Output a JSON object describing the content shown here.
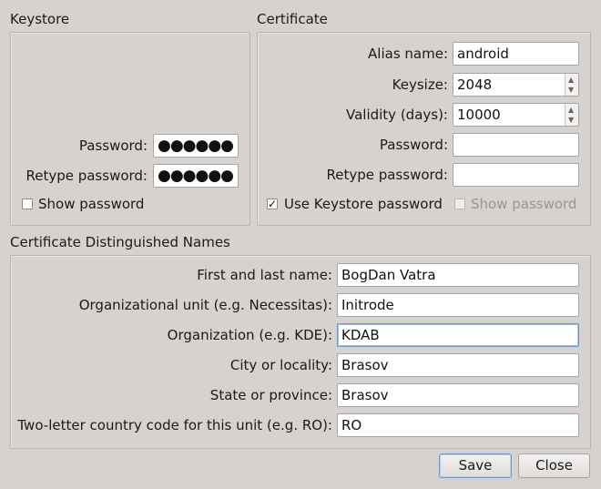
{
  "keystore": {
    "title": "Keystore",
    "password_label": "Password:",
    "password_value": "●●●●●●",
    "retype_label": "Retype password:",
    "retype_value": "●●●●●●",
    "show_password_label": "Show password",
    "show_password_checked": false
  },
  "certificate": {
    "title": "Certificate",
    "alias_label": "Alias name:",
    "alias_value": "android",
    "keysize_label": "Keysize:",
    "keysize_value": "2048",
    "validity_label": "Validity (days):",
    "validity_value": "10000",
    "password_label": "Password:",
    "password_value": "",
    "retype_label": "Retype password:",
    "retype_value": "",
    "use_keystore_password_label": "Use Keystore password",
    "use_keystore_password_checked": true,
    "use_keystore_password_mark": "✓",
    "show_password_label": "Show password",
    "show_password_enabled": false
  },
  "dn": {
    "title": "Certificate Distinguished Names",
    "fields": [
      {
        "label": "First and last name:",
        "value": "BogDan Vatra"
      },
      {
        "label": "Organizational unit (e.g. Necessitas):",
        "value": "Initrode"
      },
      {
        "label": "Organization (e.g. KDE):",
        "value": "KDAB"
      },
      {
        "label": "City or locality:",
        "value": "Brasov"
      },
      {
        "label": "State or province:",
        "value": "Brasov"
      },
      {
        "label": "Two-letter country code for this unit (e.g. RO):",
        "value": "RO"
      }
    ]
  },
  "buttons": {
    "save": "Save",
    "close": "Close"
  },
  "colors": {
    "background": "#d6d2d0",
    "focus": "#6f98c8"
  }
}
